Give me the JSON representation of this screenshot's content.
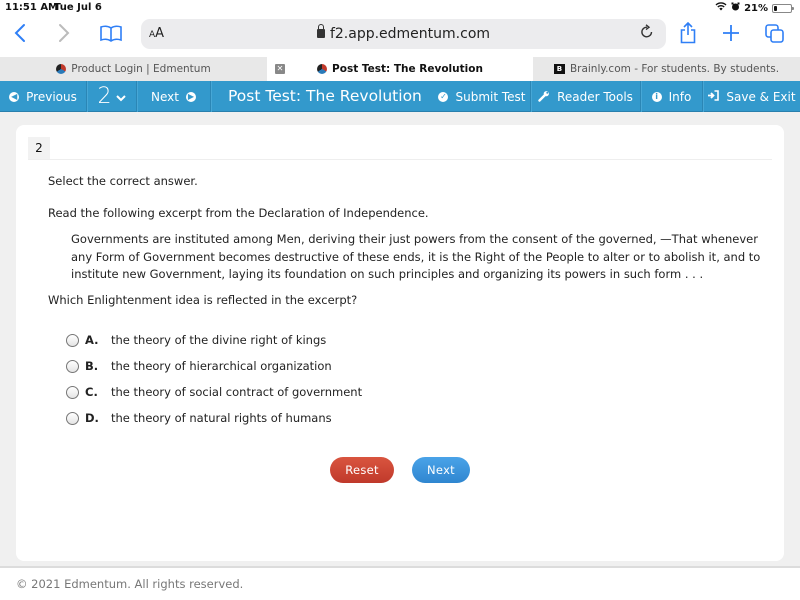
{
  "status_bar": {
    "time": "11:51 AM",
    "date": "Tue Jul 6",
    "battery_percent_label": "21%",
    "battery_level": 0.21,
    "icons": [
      "wifi-icon",
      "alarm-icon",
      "battery-icon"
    ]
  },
  "browser": {
    "reader_label_small": "A",
    "reader_label_large": "A",
    "url": "f2.app.edmentum.com",
    "icons": {
      "back": "‹",
      "forward": "›",
      "bookmarks": "📖",
      "reload": "↻",
      "share": "⇪",
      "new_tab": "+",
      "tabs": "❐"
    },
    "tabs": [
      {
        "label": "Product Login | Edmentum",
        "active": false
      },
      {
        "label": "Post Test: The Revolution",
        "active": true
      },
      {
        "label": "Brainly.com - For students. By students.",
        "active": false
      }
    ]
  },
  "navbar": {
    "previous_label": "Previous",
    "question_number": "2",
    "next_label": "Next",
    "title": "Post Test: The Revolution",
    "submit_label": "Submit Test",
    "reader_tools_label": "Reader Tools",
    "info_label": "Info",
    "save_exit_label": "Save & Exit",
    "accent_color": "#3399cc"
  },
  "question": {
    "number": "2",
    "instruction": "Select the correct answer.",
    "lead": "Read the following excerpt from the Declaration of Independence.",
    "excerpt": "Governments are instituted among Men, deriving their just powers from the consent of the governed, —That whenever any Form of Government becomes destructive of these ends, it is the Right of the People to alter or to abolish it, and to institute new Government, laying its foundation on such principles and organizing its powers in such form . . .",
    "prompt": "Which Enlightenment idea is reflected in the excerpt?",
    "options": [
      {
        "letter": "A.",
        "text": "the theory of the divine right of kings",
        "selected": false
      },
      {
        "letter": "B.",
        "text": "the theory of hierarchical organization",
        "selected": false
      },
      {
        "letter": "C.",
        "text": "the theory of social contract of government",
        "selected": false
      },
      {
        "letter": "D.",
        "text": "the theory of natural rights of humans",
        "selected": false
      }
    ],
    "reset_label": "Reset",
    "next_label": "Next",
    "reset_color": "#c9473a",
    "next_color": "#3b94dc"
  },
  "footer": {
    "copyright": "© 2021 Edmentum. All rights reserved."
  }
}
